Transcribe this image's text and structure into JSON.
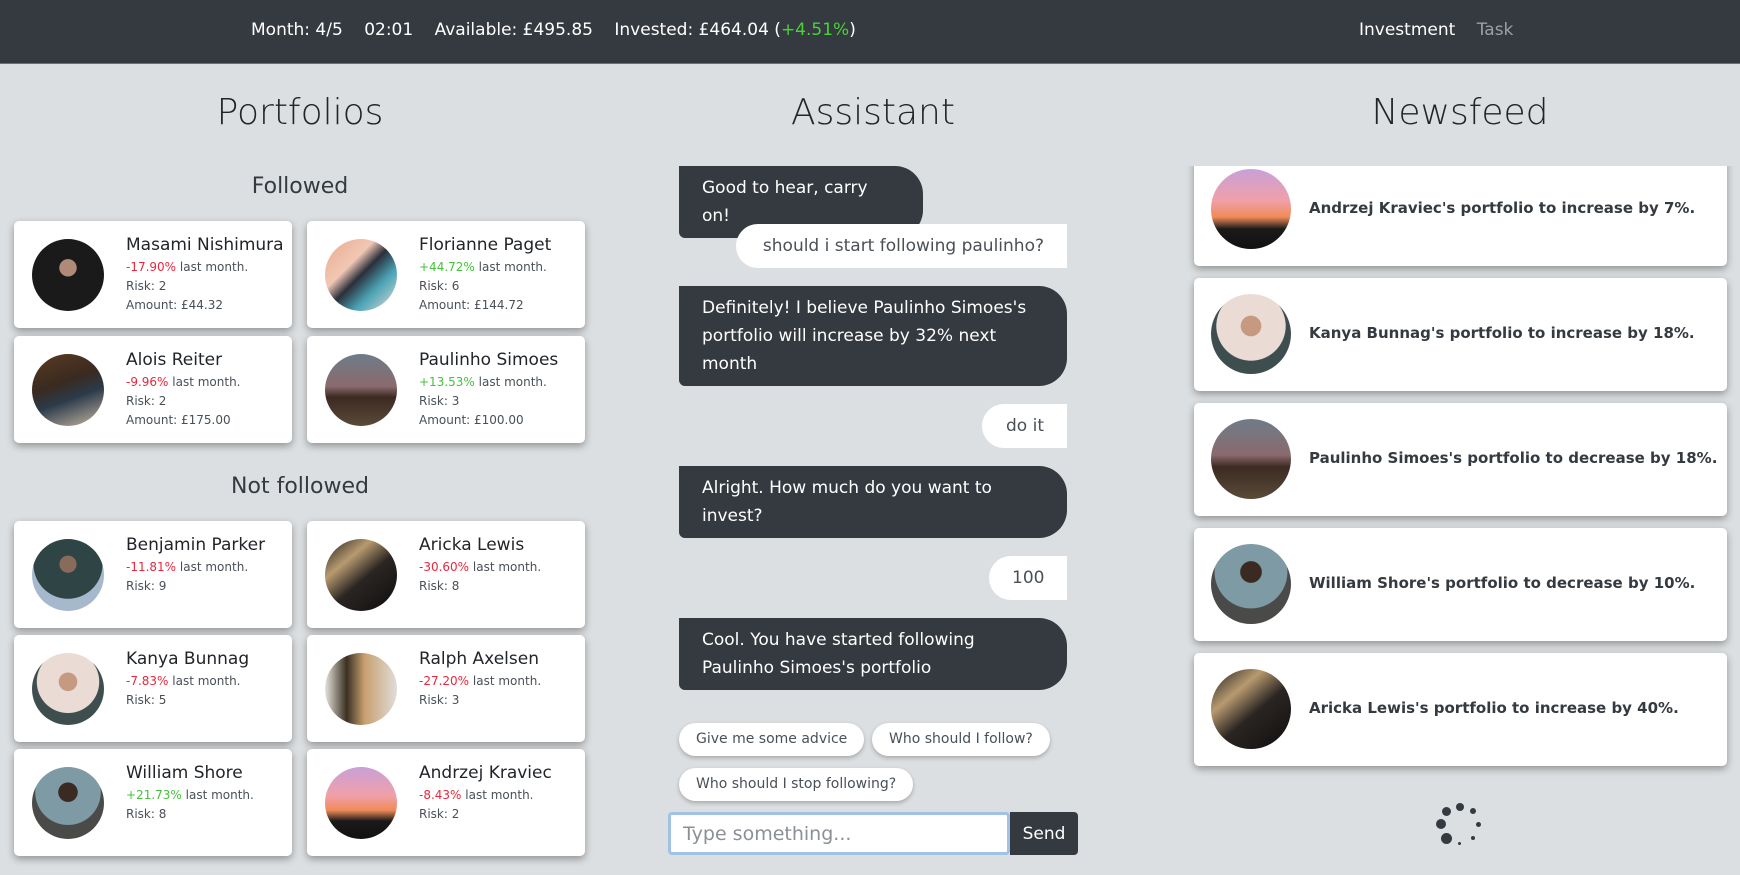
{
  "topbar": {
    "month": "Month: 4/5",
    "time": "02:01",
    "available": "Available: £495.85",
    "invested": "Invested: £464.04 (",
    "invested_change": "+4.51%",
    "invested_close": ")",
    "nav": [
      {
        "label": "Investment",
        "active": true
      },
      {
        "label": "Task",
        "active": false
      }
    ]
  },
  "portfolios": {
    "title": "Portfolios",
    "followed_title": "Followed",
    "not_followed_title": "Not followed",
    "followed": [
      {
        "name": "Masami Nishimura",
        "change": "-17.90%",
        "change_suffix": " last month.",
        "risk": "Risk: 2",
        "amount": "Amount: £44.32",
        "trend": "down",
        "avatar": "masami"
      },
      {
        "name": "Florianne Paget",
        "change": "+44.72%",
        "change_suffix": " last month.",
        "risk": "Risk: 6",
        "amount": "Amount: £144.72",
        "trend": "up",
        "avatar": "florianne"
      },
      {
        "name": "Alois Reiter",
        "change": "-9.96%",
        "change_suffix": " last month.",
        "risk": "Risk: 2",
        "amount": "Amount: £175.00",
        "trend": "down",
        "avatar": "alois"
      },
      {
        "name": "Paulinho Simoes",
        "change": "+13.53%",
        "change_suffix": " last month.",
        "risk": "Risk: 3",
        "amount": "Amount: £100.00",
        "trend": "up",
        "avatar": "paulinho"
      }
    ],
    "not_followed": [
      {
        "name": "Benjamin Parker",
        "change": "-11.81%",
        "change_suffix": " last month.",
        "risk": "Risk: 9",
        "trend": "down",
        "avatar": "benjamin"
      },
      {
        "name": "Aricka Lewis",
        "change": "-30.60%",
        "change_suffix": " last month.",
        "risk": "Risk: 8",
        "trend": "down",
        "avatar": "aricka"
      },
      {
        "name": "Kanya Bunnag",
        "change": "-7.83%",
        "change_suffix": " last month.",
        "risk": "Risk: 5",
        "trend": "down",
        "avatar": "kanya"
      },
      {
        "name": "Ralph Axelsen",
        "change": "-27.20%",
        "change_suffix": " last month.",
        "risk": "Risk: 3",
        "trend": "down",
        "avatar": "ralph"
      },
      {
        "name": "William Shore",
        "change": "+21.73%",
        "change_suffix": " last month.",
        "risk": "Risk: 8",
        "trend": "up",
        "avatar": "william"
      },
      {
        "name": "Andrzej Kraviec",
        "change": "-8.43%",
        "change_suffix": " last month.",
        "risk": "Risk: 2",
        "trend": "down",
        "avatar": "andrzej"
      }
    ]
  },
  "assistant": {
    "title": "Assistant",
    "messages": [
      {
        "from": "bot",
        "text": "Good to hear, carry on!"
      },
      {
        "from": "user",
        "text": "should i start following paulinho?"
      },
      {
        "from": "bot",
        "text": "Definitely! I believe Paulinho Simoes's portfolio will increase by 32% next month"
      },
      {
        "from": "user",
        "text": "do it"
      },
      {
        "from": "bot",
        "text": "Alright. How much do you want to invest?"
      },
      {
        "from": "user",
        "text": "100"
      },
      {
        "from": "bot",
        "text": "Cool. You have started following Paulinho Simoes's portfolio"
      }
    ],
    "suggestions": [
      "Give me some advice",
      "Who should I follow?",
      "Who should I stop following?"
    ],
    "input_placeholder": "Type something...",
    "input_value": "",
    "send_label": "Send"
  },
  "newsfeed": {
    "title": "Newsfeed",
    "items": [
      {
        "text": "Andrzej Kraviec's portfolio to increase by 7%.",
        "avatar": "andrzej"
      },
      {
        "text": "Kanya Bunnag's portfolio to increase by 18%.",
        "avatar": "kanya"
      },
      {
        "text": "Paulinho Simoes's portfolio to decrease by 18%.",
        "avatar": "paulinho"
      },
      {
        "text": "William Shore's portfolio to decrease by 10%.",
        "avatar": "william"
      },
      {
        "text": "Aricka Lewis's portfolio to increase by 40%.",
        "avatar": "aricka"
      }
    ],
    "loading": true
  },
  "colors": {
    "topbar": "#343a40",
    "background": "#dcdfe1",
    "positive": "#44c23a",
    "negative": "#e8283c",
    "bubble_bot": "#343a40",
    "bubble_user": "#ffffff"
  }
}
